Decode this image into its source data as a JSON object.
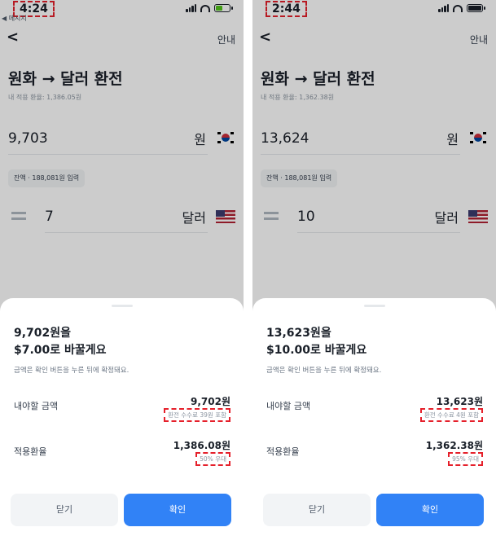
{
  "screens": [
    {
      "status_bar": {
        "time": "4:24",
        "back_app": "◀ 메시지",
        "battery_color": "#52c41a",
        "battery_level": 0.5
      },
      "nav": {
        "back": "<",
        "help": "안내"
      },
      "title": "원화 → 달러 환전",
      "rate_caption": "내 적용 환율: 1,386.05원",
      "krw": {
        "amount": "9,703",
        "unit": "원",
        "flag": "kr-flag-icon"
      },
      "balance_chip": "잔액 · 188,081원 입력",
      "usd": {
        "amount": "7",
        "unit": "달러",
        "flag": "us-flag-icon"
      },
      "sheet": {
        "line1": "9,702원을",
        "line2": "$7.00로 바꿀게요",
        "note": "금액은 확인 버튼을 누른 뒤에 확정돼요.",
        "pay_label": "내야할 금액",
        "pay_value": "9,702원",
        "fee_note": "환전 수수료 39원 포함",
        "rate_label": "적용환율",
        "rate_value": "1,386.08원",
        "discount_note": "50% 우대",
        "close_label": "닫기",
        "confirm_label": "확인"
      }
    },
    {
      "status_bar": {
        "time": "2:44",
        "back_app": "",
        "battery_color": "#191f28",
        "battery_level": 1.0
      },
      "nav": {
        "back": "<",
        "help": "안내"
      },
      "title": "원화 → 달러 환전",
      "rate_caption": "내 적용 환율: 1,362.38원",
      "krw": {
        "amount": "13,624",
        "unit": "원",
        "flag": "kr-flag-icon"
      },
      "balance_chip": "잔액 · 188,081원 입력",
      "usd": {
        "amount": "10",
        "unit": "달러",
        "flag": "us-flag-icon"
      },
      "sheet": {
        "line1": "13,623원을",
        "line2": "$10.00로 바꿀게요",
        "note": "금액은 확인 버튼을 누른 뒤에 확정돼요.",
        "pay_label": "내야할 금액",
        "pay_value": "13,623원",
        "fee_note": "환전 수수료 4원 포함",
        "rate_label": "적용환율",
        "rate_value": "1,362.38원",
        "discount_note": "95% 우대",
        "close_label": "닫기",
        "confirm_label": "확인"
      }
    }
  ]
}
